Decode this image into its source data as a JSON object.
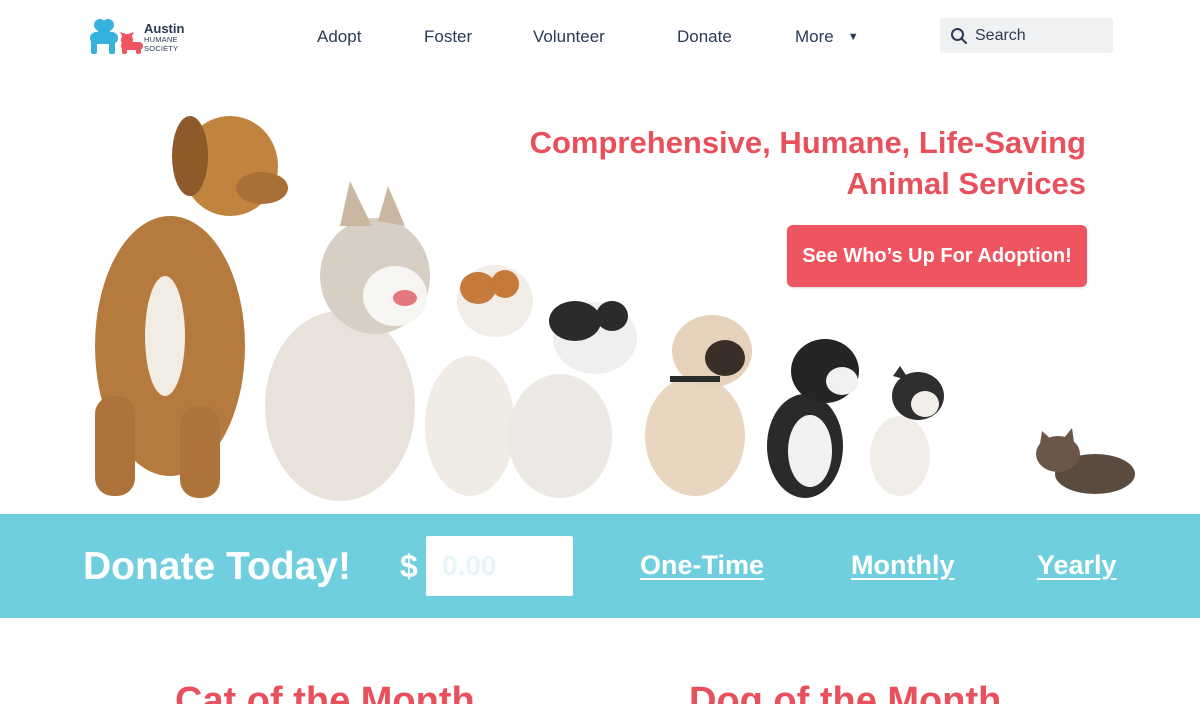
{
  "brand": {
    "line1": "Austin",
    "line2": "HUMANE",
    "line3": "SOCIETY",
    "colors": {
      "blue": "#36b3dc",
      "pink": "#ef5461"
    }
  },
  "nav": {
    "items": [
      {
        "label": "Adopt"
      },
      {
        "label": "Foster"
      },
      {
        "label": "Volunteer"
      },
      {
        "label": "Donate"
      },
      {
        "label": "More"
      }
    ],
    "more_icon": "caret-down-icon"
  },
  "search": {
    "placeholder": "Search",
    "icon": "search-icon"
  },
  "hero": {
    "title_line1": "Comprehensive, Humane, Life-Saving",
    "title_line2": "Animal Services",
    "cta": "See Who’s Up For Adoption!",
    "accent": "#e8505b"
  },
  "donate": {
    "title": "Donate Today!",
    "currency": "$",
    "amount_placeholder": "0.00",
    "options": [
      "One-Time",
      "Monthly",
      "Yearly"
    ],
    "band_color": "#6fcfdf"
  },
  "features": {
    "cat_title": "Cat of the Month",
    "dog_title": "Dog of the Month"
  }
}
